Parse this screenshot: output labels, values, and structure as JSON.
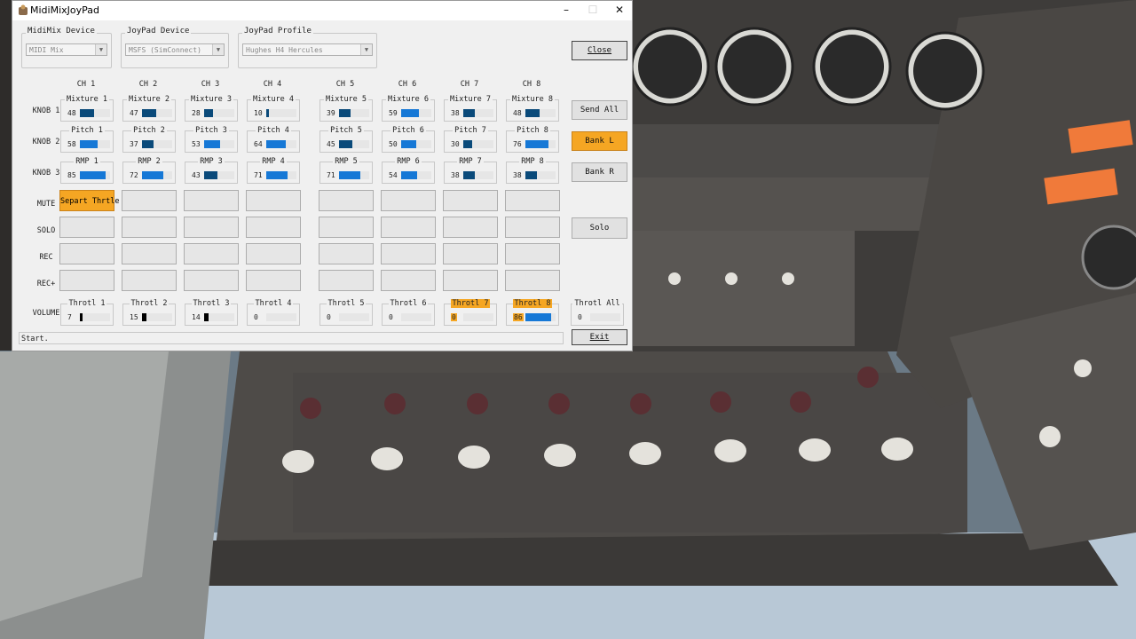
{
  "window": {
    "title": "MidiMixJoyPad"
  },
  "groups": {
    "midimix": {
      "label": "MidiMix Device",
      "value": "MIDI Mix"
    },
    "joypad": {
      "label": "JoyPad Device",
      "value": "MSFS (SimConnect)"
    },
    "profile": {
      "label": "JoyPad Profile",
      "value": "Hughes H4 Hercules"
    }
  },
  "channels": [
    "CH 1",
    "CH 2",
    "CH 3",
    "CH 4",
    "CH 5",
    "CH 6",
    "CH 7",
    "CH 8"
  ],
  "row_labels": {
    "knob1": "KNOB 1",
    "knob2": "KNOB 2",
    "knob3": "KNOB 3",
    "mute": "MUTE",
    "solo": "SOLO",
    "rec": "REC",
    "recplus": "REC+",
    "volume": "VOLUME"
  },
  "knob1": [
    {
      "label": "Mixture 1",
      "value": "48",
      "level": 0.48
    },
    {
      "label": "Mixture 2",
      "value": "47",
      "level": 0.47
    },
    {
      "label": "Mixture 3",
      "value": "28",
      "level": 0.28
    },
    {
      "label": "Mixture 4",
      "value": "10",
      "level": 0.1
    },
    {
      "label": "Mixture 5",
      "value": "39",
      "level": 0.39
    },
    {
      "label": "Mixture 6",
      "value": "59",
      "level": 0.59
    },
    {
      "label": "Mixture 7",
      "value": "38",
      "level": 0.38
    },
    {
      "label": "Mixture 8",
      "value": "48",
      "level": 0.48
    }
  ],
  "knob2": [
    {
      "label": "Pitch 1",
      "value": "58",
      "level": 0.58
    },
    {
      "label": "Pitch 2",
      "value": "37",
      "level": 0.37
    },
    {
      "label": "Pitch 3",
      "value": "53",
      "level": 0.53
    },
    {
      "label": "Pitch 4",
      "value": "64",
      "level": 0.64
    },
    {
      "label": "Pitch 5",
      "value": "45",
      "level": 0.45
    },
    {
      "label": "Pitch 6",
      "value": "50",
      "level": 0.5
    },
    {
      "label": "Pitch 7",
      "value": "30",
      "level": 0.3
    },
    {
      "label": "Pitch 8",
      "value": "76",
      "level": 0.76
    }
  ],
  "knob3": [
    {
      "label": "RMP 1",
      "value": "85",
      "level": 0.85
    },
    {
      "label": "RMP 2",
      "value": "72",
      "level": 0.72
    },
    {
      "label": "RMP 3",
      "value": "43",
      "level": 0.43
    },
    {
      "label": "RMP 4",
      "value": "71",
      "level": 0.71
    },
    {
      "label": "RMP 5",
      "value": "71",
      "level": 0.71
    },
    {
      "label": "RMP 6",
      "value": "54",
      "level": 0.54
    },
    {
      "label": "RMP 7",
      "value": "38",
      "level": 0.38
    },
    {
      "label": "RMP 8",
      "value": "38",
      "level": 0.38
    }
  ],
  "mute_button_1": "Separt Thrtle",
  "volume": [
    {
      "label": "Throtl 1",
      "value": "7",
      "level": 0.07
    },
    {
      "label": "Throtl 2",
      "value": "15",
      "level": 0.15
    },
    {
      "label": "Throtl 3",
      "value": "14",
      "level": 0.14
    },
    {
      "label": "Throtl 4",
      "value": "0",
      "level": 0
    },
    {
      "label": "Throtl 5",
      "value": "0",
      "level": 0
    },
    {
      "label": "Throtl 6",
      "value": "0",
      "level": 0
    },
    {
      "label": "Throtl 7",
      "value": "0",
      "level": 0
    },
    {
      "label": "Throtl 8",
      "value": "86",
      "level": 0.86
    }
  ],
  "volume_all": {
    "label": "Throtl All",
    "value": "0"
  },
  "buttons": {
    "close": "Close",
    "send_all": "Send All",
    "bank_l": "Bank L",
    "bank_r": "Bank R",
    "solo": "Solo",
    "exit": "Exit"
  },
  "status": "Start.",
  "colors": {
    "accent": "#f5a623",
    "bar_dark": "#0a4a7a",
    "bar_blue": "#1678d6"
  }
}
